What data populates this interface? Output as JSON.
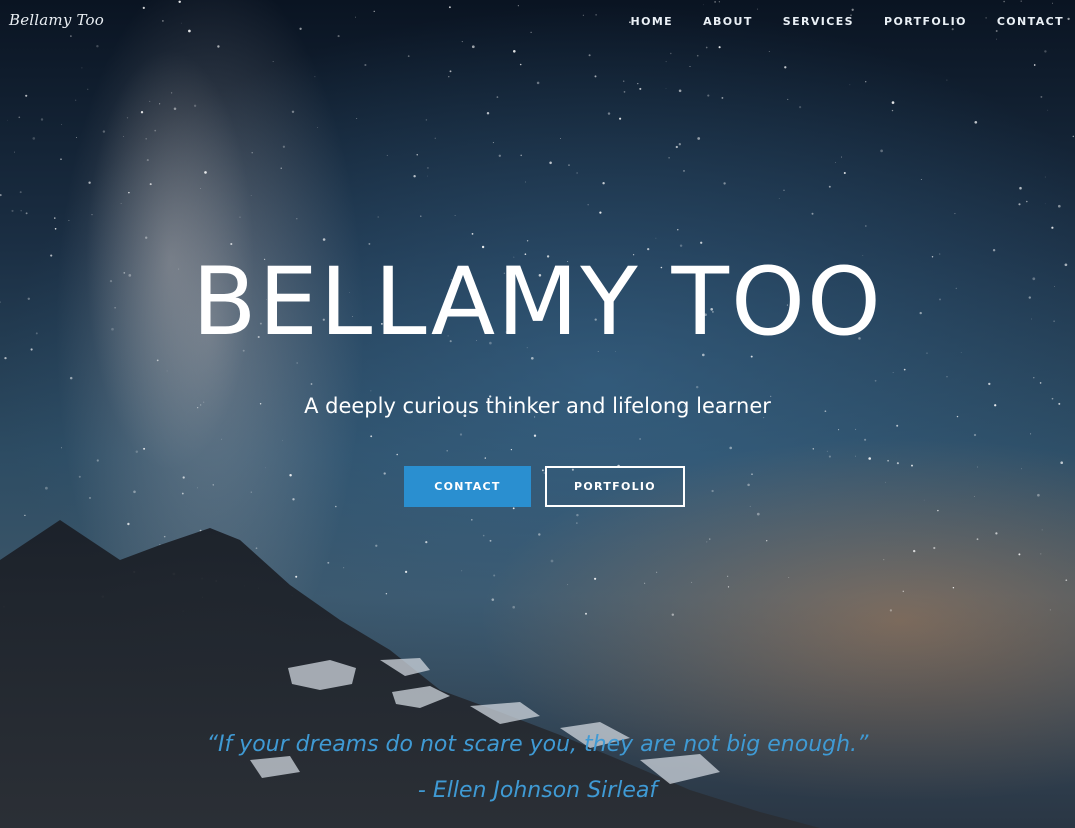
{
  "site": {
    "logo": "Bellamy Too"
  },
  "nav": {
    "items": [
      {
        "label": "HOME"
      },
      {
        "label": "ABOUT"
      },
      {
        "label": "SERVICES"
      },
      {
        "label": "PORTFOLIO"
      },
      {
        "label": "CONTACT"
      }
    ]
  },
  "hero": {
    "title": "BELLAMY TOO",
    "subtitle": "A deeply curious thinker and lifelong learner",
    "buttons": {
      "contact": "CONTACT",
      "portfolio": "PORTFOLIO"
    },
    "background_image": "night-sky-milky-way-mountain"
  },
  "quote": {
    "text": "“If your dreams do not scare you, they are not big enough.”",
    "author": "- Ellen Johnson Sirleaf"
  },
  "colors": {
    "accent_blue": "#2a8fd0",
    "quote_blue": "#3f9ad4",
    "text_white": "#ffffff"
  }
}
